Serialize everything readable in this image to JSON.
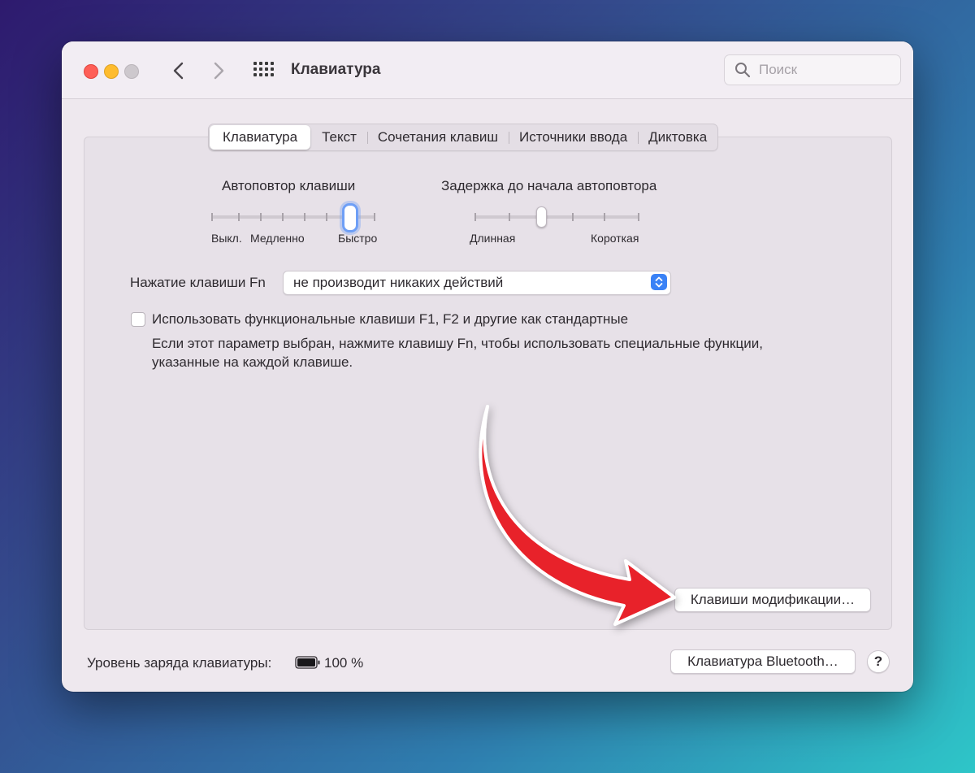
{
  "window": {
    "title": "Клавиатура",
    "search_placeholder": "Поиск"
  },
  "tabs": [
    {
      "label": "Клавиатура",
      "active": true
    },
    {
      "label": "Текст",
      "active": false
    },
    {
      "label": "Сочетания клавиш",
      "active": false
    },
    {
      "label": "Источники ввода",
      "active": false
    },
    {
      "label": "Диктовка",
      "active": false
    }
  ],
  "key_repeat": {
    "title": "Автоповтор клавиши",
    "labels": [
      "Выкл.",
      "Медленно",
      "Быстро"
    ],
    "value_fraction": 0.84
  },
  "repeat_delay": {
    "title": "Задержка до начала автоповтора",
    "labels": [
      "Длинная",
      "Короткая"
    ],
    "value_fraction": 0.4
  },
  "fn_key": {
    "label": "Нажатие клавиши Fn",
    "selected": "не производит никаких действий"
  },
  "function_keys": {
    "checked": false,
    "label": "Использовать функциональные клавиши F1, F2 и другие как стандартные",
    "description": "Если этот параметр выбран, нажмите клавишу Fn, чтобы использовать специальные функции, указанные на каждой клавише."
  },
  "buttons": {
    "modifier_keys": "Клавиши модификации…",
    "bluetooth_keyboard": "Клавиатура Bluetooth…",
    "help": "?"
  },
  "battery": {
    "label": "Уровень заряда клавиатуры:",
    "value": "100 %"
  },
  "colors": {
    "accent": "#3a82f6",
    "arrow": "#e8202a"
  }
}
